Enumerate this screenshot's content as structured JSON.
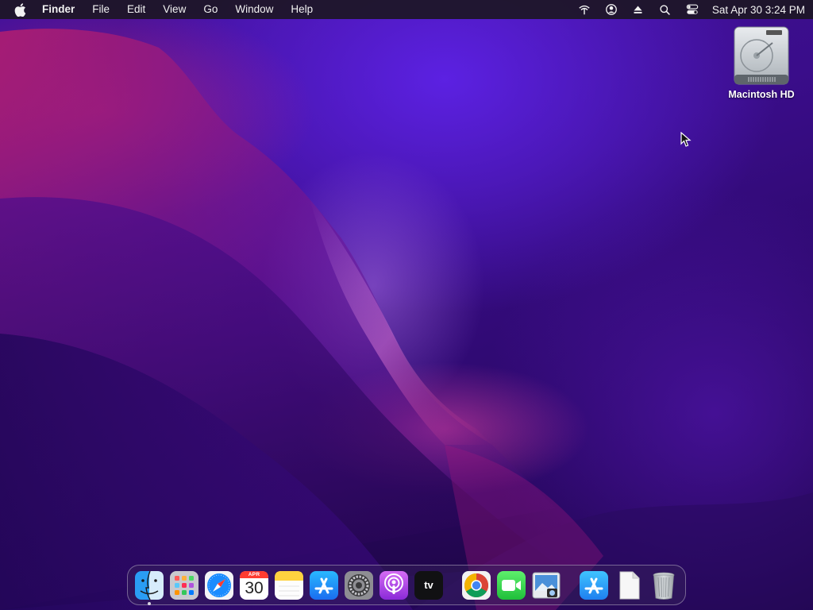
{
  "menubar": {
    "apple_icon": "apple-logo-icon",
    "app_name": "Finder",
    "menus": [
      "File",
      "Edit",
      "View",
      "Go",
      "Window",
      "Help"
    ],
    "status_icons": [
      "wifi-icon",
      "user-account-icon",
      "eject-icon",
      "spotlight-search-icon",
      "control-center-icon"
    ],
    "clock": "Sat Apr 30  3:24 PM"
  },
  "desktop": {
    "items": [
      {
        "label": "Macintosh HD",
        "icon": "hard-drive-icon"
      }
    ]
  },
  "dock": {
    "apps": [
      {
        "name": "finder",
        "icon": "finder-icon",
        "running": true
      },
      {
        "name": "launchpad",
        "icon": "launchpad-icon"
      },
      {
        "name": "safari",
        "icon": "safari-icon"
      },
      {
        "name": "calendar",
        "icon": "calendar-icon",
        "month": "APR",
        "day": "30"
      },
      {
        "name": "notes",
        "icon": "notes-icon"
      },
      {
        "name": "app-store",
        "icon": "app-store-icon"
      },
      {
        "name": "system-preferences",
        "icon": "gear-icon"
      },
      {
        "name": "podcasts",
        "icon": "podcasts-icon"
      },
      {
        "name": "apple-tv",
        "icon": "apple-tv-icon",
        "label": "tv"
      },
      {
        "name": "chrome",
        "icon": "chrome-icon"
      },
      {
        "name": "facetime",
        "icon": "facetime-icon"
      },
      {
        "name": "preview",
        "icon": "preview-icon"
      },
      {
        "name": "applications-folder",
        "icon": "app-store-icon"
      },
      {
        "name": "document",
        "icon": "document-icon"
      },
      {
        "name": "trash",
        "icon": "trash-icon"
      }
    ]
  },
  "colors": {
    "menubar_bg": "#1c1624",
    "wallpaper_base": "#3a0d8a",
    "wallpaper_ridge": "#c0267e",
    "dock_accent": "#1a8cff"
  }
}
